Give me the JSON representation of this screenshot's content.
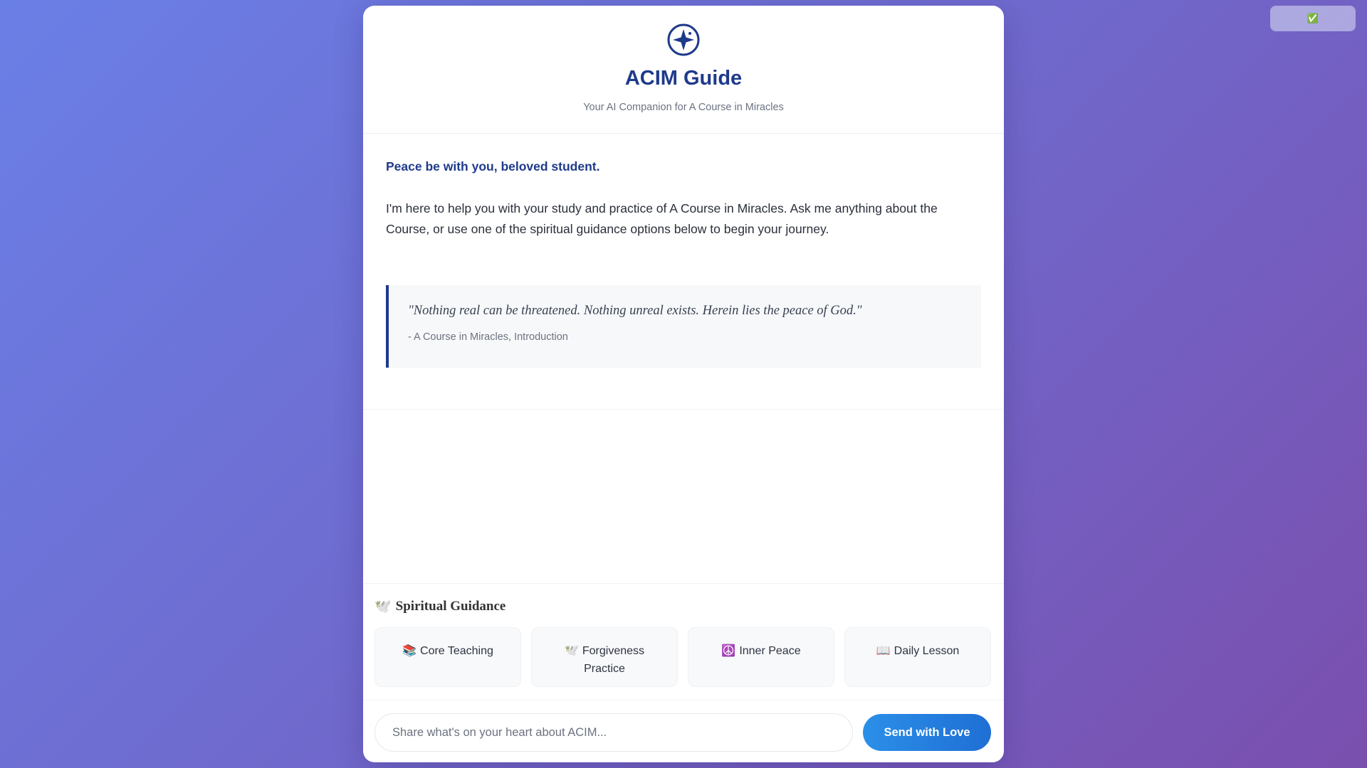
{
  "status_badge": {
    "icon": "✅"
  },
  "header": {
    "logo_icon": "star-compass-icon",
    "title": "ACIM Guide",
    "subtitle": "Your AI Companion for A Course in Miracles"
  },
  "messages": {
    "greeting": "Peace be with you, beloved student.",
    "intro": "I'm here to help you with your study and practice of A Course in Miracles. Ask me anything about the Course, or use one of the spiritual guidance options below to begin your journey.",
    "quote": {
      "text": "\"Nothing real can be threatened. Nothing unreal exists. Herein lies the peace of God.\"",
      "source": "- A Course in Miracles, Introduction"
    }
  },
  "guidance": {
    "icon": "🕊️",
    "title": "Spiritual Guidance",
    "buttons": [
      {
        "icon": "📚",
        "label": "Core Teaching"
      },
      {
        "icon": "🕊️",
        "label": "Forgiveness Practice"
      },
      {
        "icon": "☮️",
        "label": "Inner Peace"
      },
      {
        "icon": "📖",
        "label": "Daily Lesson"
      }
    ]
  },
  "composer": {
    "placeholder": "Share what's on your heart about ACIM...",
    "send_label": "Send with Love"
  },
  "colors": {
    "brand": "#1e3a8a",
    "send_button": "#2b8fe8",
    "background_start": "#6a7fe6",
    "background_end": "#7a4fae"
  }
}
